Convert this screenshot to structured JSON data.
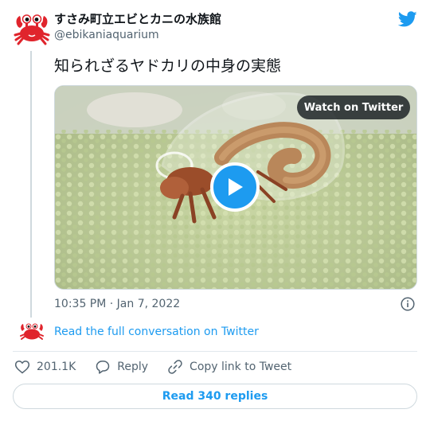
{
  "author": {
    "name": "すさみ町立エビとカニの水族館",
    "handle": "@ebikaniaquarium"
  },
  "tweet": {
    "text": "知られざるヤドカリの中身の実態",
    "timestamp": "10:35 PM · Jan 7, 2022"
  },
  "media": {
    "watch_label": "Watch on Twitter"
  },
  "conversation": {
    "link_label": "Read the full conversation on Twitter"
  },
  "actions": {
    "likes": "201.1K",
    "reply_label": "Reply",
    "copy_label": "Copy link to Tweet"
  },
  "replies": {
    "label": "Read 340 replies"
  },
  "colors": {
    "accent": "#1d9bf0",
    "crab": "#e0242c",
    "text": "#0f1419",
    "muted": "#536471"
  },
  "icons": [
    "crab-avatar-icon",
    "twitter-bird-icon",
    "play-icon",
    "info-icon",
    "heart-icon",
    "reply-bubble-icon",
    "link-icon"
  ]
}
